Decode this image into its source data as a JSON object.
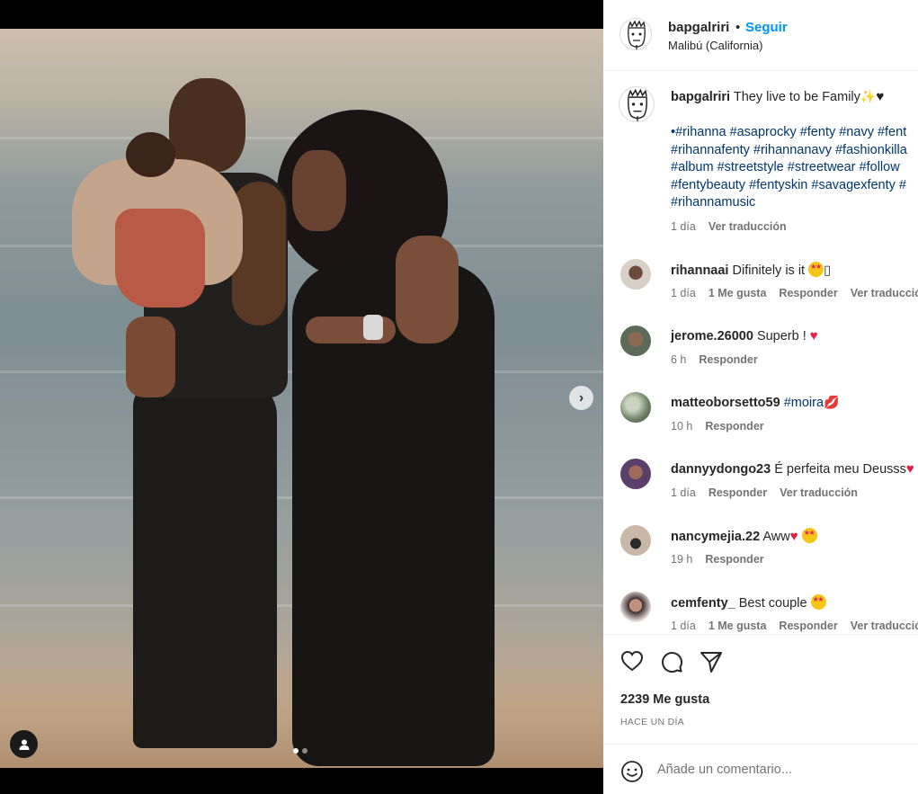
{
  "post": {
    "username": "bapgalriri",
    "bullet": "•",
    "follow_label": "Seguir",
    "location": "Malibú (California)"
  },
  "caption": {
    "username": "bapgalriri",
    "text": "They live to be Family",
    "hashtag_lines": [
      "•#rihanna #asaprocky #fenty #navy #fent",
      "#rihannafenty #rihannanavy #fashionkilla",
      "#album #streetstyle #streetwear #follow",
      "#fentybeauty #fentyskin #savagexfenty #",
      "#rihannamusic"
    ],
    "time": "1 día",
    "translate": "Ver traducción"
  },
  "comments": [
    {
      "username": "rihannaai",
      "text": "Difinitely is it",
      "suffix": "▯",
      "time": "1 día",
      "likes": "1 Me gusta",
      "reply": "Responder",
      "translate": "Ver traducción"
    },
    {
      "username": "jerome.26000",
      "text": "Superb ! ",
      "time": "6 h",
      "reply": "Responder"
    },
    {
      "username": "matteoborsetto59",
      "link": "#moira",
      "time": "10 h",
      "reply": "Responder"
    },
    {
      "username": "dannyydongo23",
      "text": "É perfeita meu Deusss",
      "time": "1 día",
      "reply": "Responder",
      "translate": "Ver traducción"
    },
    {
      "username": "nancymejia.22",
      "text": "Aww",
      "time": "19 h",
      "reply": "Responder"
    },
    {
      "username": "cemfenty_",
      "text": "Best couple ",
      "time": "1 día",
      "likes": "1 Me gusta",
      "reply": "Responder",
      "translate": "Ver traducción"
    }
  ],
  "actions": {
    "likes": "2239 Me gusta",
    "time": "HACE UN DÍA"
  },
  "composer": {
    "placeholder": "Añade un comentario..."
  },
  "icons": [
    "heart-icon",
    "comment-icon",
    "share-icon",
    "emoji-icon",
    "chevron-right-icon",
    "user-tag-icon"
  ],
  "colors": {
    "accent": "#0095f6",
    "link": "#00376b",
    "muted": "#737373"
  }
}
